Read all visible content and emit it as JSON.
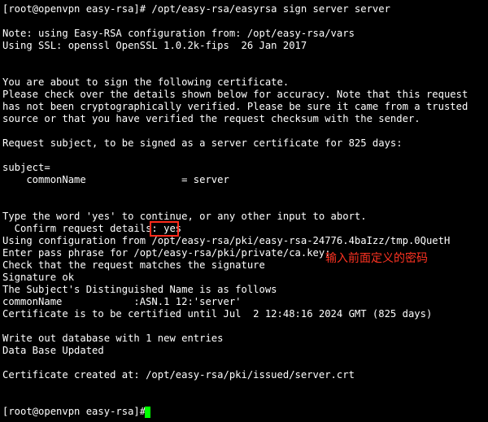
{
  "terminal": {
    "lines": [
      "[root@openvpn easy-rsa]# /opt/easy-rsa/easyrsa sign server server",
      "",
      "Note: using Easy-RSA configuration from: /opt/easy-rsa/vars",
      "Using SSL: openssl OpenSSL 1.0.2k-fips  26 Jan 2017",
      "",
      "",
      "You are about to sign the following certificate.",
      "Please check over the details shown below for accuracy. Note that this request",
      "has not been cryptographically verified. Please be sure it came from a trusted",
      "source or that you have verified the request checksum with the sender.",
      "",
      "Request subject, to be signed as a server certificate for 825 days:",
      "",
      "subject=",
      "    commonName                = server",
      "",
      "",
      "Type the word 'yes' to continue, or any other input to abort.",
      "  Confirm request details: yes",
      "Using configuration from /opt/easy-rsa/pki/easy-rsa-24776.4baIzz/tmp.0QuetH",
      "Enter pass phrase for /opt/easy-rsa/pki/private/ca.key:",
      "Check that the request matches the signature",
      "Signature ok",
      "The Subject's Distinguished Name is as follows",
      "commonName            :ASN.1 12:'server'",
      "Certificate is to be certified until Jul  2 12:48:16 2024 GMT (825 days)",
      "",
      "Write out database with 1 new entries",
      "Data Base Updated",
      "",
      "Certificate created at: /opt/easy-rsa/pki/issued/server.crt",
      "",
      "",
      "[root@openvpn easy-rsa]# "
    ]
  },
  "annotation": {
    "text": "输入前面定义的密码"
  },
  "colors": {
    "background": "#000000",
    "text": "#ffffff",
    "highlight_border": "#ff2a1a",
    "annotation_text": "#ff3322",
    "cursor": "#00ff00"
  }
}
